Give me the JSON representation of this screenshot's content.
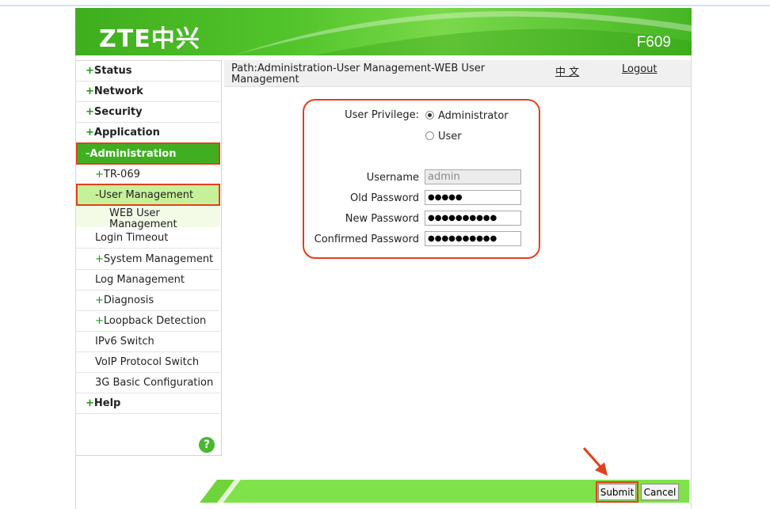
{
  "header": {
    "logo": "ZTE中兴",
    "model": "F609"
  },
  "sidebar": {
    "items": [
      {
        "prefix": "+",
        "label": "Status"
      },
      {
        "prefix": "+",
        "label": "Network"
      },
      {
        "prefix": "+",
        "label": "Security"
      },
      {
        "prefix": "+",
        "label": "Application"
      },
      {
        "prefix": "-",
        "label": "Administration"
      },
      {
        "prefix": "+",
        "label": "TR-069"
      },
      {
        "prefix": "-",
        "label": "User Management"
      },
      {
        "prefix": "",
        "label": "WEB User Management"
      },
      {
        "prefix": "",
        "label": "Login Timeout"
      },
      {
        "prefix": "+",
        "label": "System Management"
      },
      {
        "prefix": "",
        "label": "Log Management"
      },
      {
        "prefix": "+",
        "label": "Diagnosis"
      },
      {
        "prefix": "+",
        "label": "Loopback Detection"
      },
      {
        "prefix": "",
        "label": "IPv6 Switch"
      },
      {
        "prefix": "",
        "label": "VoIP Protocol Switch"
      },
      {
        "prefix": "",
        "label": "3G Basic Configuration"
      },
      {
        "prefix": "+",
        "label": "Help"
      }
    ],
    "help_icon": "?"
  },
  "pathbar": {
    "path": "Path:Administration-User Management-WEB User Management",
    "language": "中 文",
    "logout": "Logout"
  },
  "form": {
    "privilege_label": "User Privilege:",
    "option_admin": "Administrator",
    "option_user": "User",
    "selected_privilege": "Administrator",
    "username_label": "Username",
    "username_value": "admin",
    "old_password_label": "Old Password",
    "old_password_value": "●●●●●",
    "new_password_label": "New Password",
    "new_password_value": "●●●●●●●●●●",
    "confirm_password_label": "Confirmed Password",
    "confirm_password_value": "●●●●●●●●●●"
  },
  "buttons": {
    "submit": "Submit",
    "cancel": "Cancel"
  },
  "colors": {
    "brand_green": "#3fae20",
    "highlight_red": "#e2401c",
    "light_green": "#c6f19a"
  }
}
